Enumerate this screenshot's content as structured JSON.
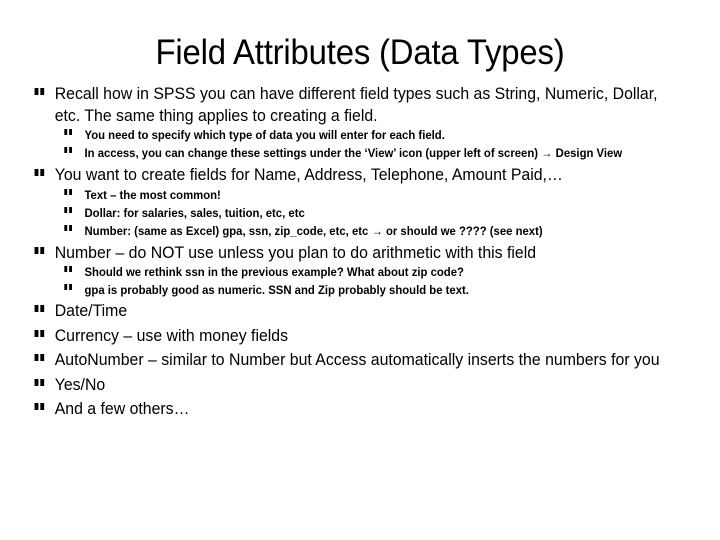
{
  "slide": {
    "title": "Field Attributes (Data Types)",
    "background_color": "#ffffff",
    "text_color": "#000000",
    "bullet_glyph": "wingdings-double-bar-bullet",
    "bullets": [
      {
        "level": 1,
        "text": "Recall how in SPSS you can have different field types such as String, Numeric, Dollar, etc.  The same thing applies to creating a field."
      },
      {
        "level": 2,
        "text": "You need to specify which type of data you will enter for each field."
      },
      {
        "level": 2,
        "text": "In access, you can change these settings under the ‘View’ icon (upper left of screen) → Design View"
      },
      {
        "level": 1,
        "text": "You want to create fields for Name, Address, Telephone, Amount Paid,…"
      },
      {
        "level": 2,
        "text": "Text – the most common!"
      },
      {
        "level": 2,
        "text": "Dollar:  for salaries, sales, tuition, etc, etc"
      },
      {
        "level": 2,
        "text": "Number: (same as Excel) gpa, ssn, zip_code, etc, etc → or should we ???? (see next)"
      },
      {
        "level": 1,
        "text": "Number – do NOT use unless you plan to do arithmetic with this field"
      },
      {
        "level": 2,
        "text": "Should we rethink ssn in the previous example? What about zip code?"
      },
      {
        "level": 2,
        "text": "gpa is probably good as numeric.  SSN and Zip probably should be text."
      },
      {
        "level": 1,
        "text": "Date/Time"
      },
      {
        "level": 1,
        "text": "Currency – use with money fields"
      },
      {
        "level": 1,
        "text": "AutoNumber – similar to Number but Access automatically inserts the numbers for you"
      },
      {
        "level": 1,
        "text": "Yes/No"
      },
      {
        "level": 1,
        "text": "And a few others…"
      }
    ]
  }
}
